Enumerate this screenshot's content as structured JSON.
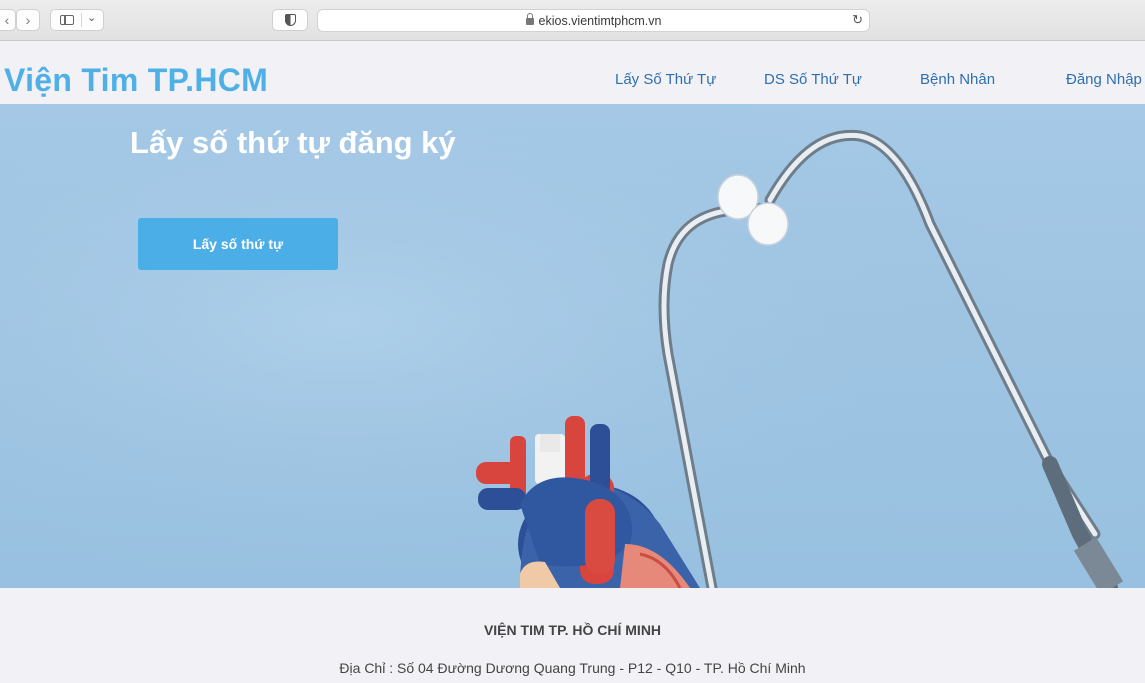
{
  "browser": {
    "url": "ekios.vientimtphcm.vn"
  },
  "header": {
    "brand": "Viện Tim TP.HCM",
    "nav": [
      {
        "label": "Lấy Số Thứ Tự"
      },
      {
        "label": "DS Số Thứ Tự"
      },
      {
        "label": "Bệnh Nhân"
      },
      {
        "label": "Đăng Nhập"
      }
    ]
  },
  "hero": {
    "title": "Lấy số thứ tự đăng ký",
    "button_label": "Lấy số thứ tự"
  },
  "footer": {
    "title": "VIỆN TIM TP. HỒ CHÍ MINH",
    "address": "Địa Chỉ : Số 04 Đường Dương Quang Trung - P12 - Q10 - TP. Hồ Chí Minh"
  },
  "colors": {
    "brand": "#4fb0e6",
    "nav_link": "#2e6fb0",
    "hero_bg": "#a5c9e6",
    "cta_bg": "#4caee6"
  }
}
